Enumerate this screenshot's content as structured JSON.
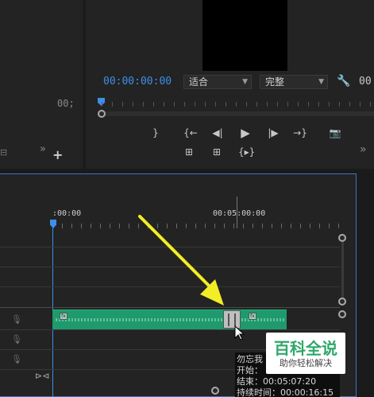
{
  "left_panel": {
    "timecode": "00;"
  },
  "program_monitor": {
    "timecode": "00:00:00:00",
    "fit_select": {
      "value": "适合"
    },
    "quality_select": {
      "value": "完整"
    },
    "right_timecode": "00"
  },
  "timeline": {
    "ruler_labels": [
      ":00:00",
      "00:05:00:00"
    ]
  },
  "tooltip": {
    "lines": [
      "勿忘我",
      "开始：",
      "结束：00:05:07:20",
      "持续时间：00:00:16:15"
    ]
  },
  "watermark": {
    "title": "百科全说",
    "subtitle": "助你轻松解决"
  },
  "colors": {
    "accent_blue": "#3d8fe8",
    "clip_green": "#1e9a6e",
    "arrow_yellow": "#f2ee25"
  }
}
